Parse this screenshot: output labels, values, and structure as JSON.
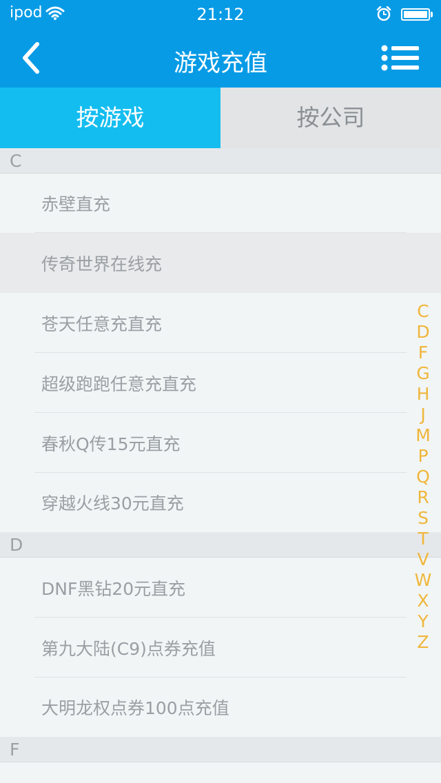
{
  "status": {
    "carrier": "ipod",
    "time": "21:12"
  },
  "nav": {
    "title": "游戏充值"
  },
  "tabs": [
    {
      "label": "按游戏",
      "active": true
    },
    {
      "label": "按公司",
      "active": false
    }
  ],
  "sections": [
    {
      "letter": "C",
      "items": [
        "赤壁直充",
        "传奇世界在线充",
        "苍天任意充直充",
        "超级跑跑任意充直充",
        "春秋Q传15元直充",
        "穿越火线30元直充"
      ]
    },
    {
      "letter": "D",
      "items": [
        "DNF黑钻20元直充",
        "第九大陆(C9)点券充值",
        "大明龙权点券100点充值"
      ]
    },
    {
      "letter": "F",
      "items": []
    }
  ],
  "index_letters": [
    "C",
    "D",
    "F",
    "G",
    "H",
    "J",
    "M",
    "P",
    "Q",
    "R",
    "S",
    "T",
    "V",
    "W",
    "X",
    "Y",
    "Z"
  ],
  "colors": {
    "header": "#079be6",
    "tab_active": "#14bdf0",
    "tab_inactive": "#e2e4e5",
    "index_letter": "#f0b63a"
  }
}
